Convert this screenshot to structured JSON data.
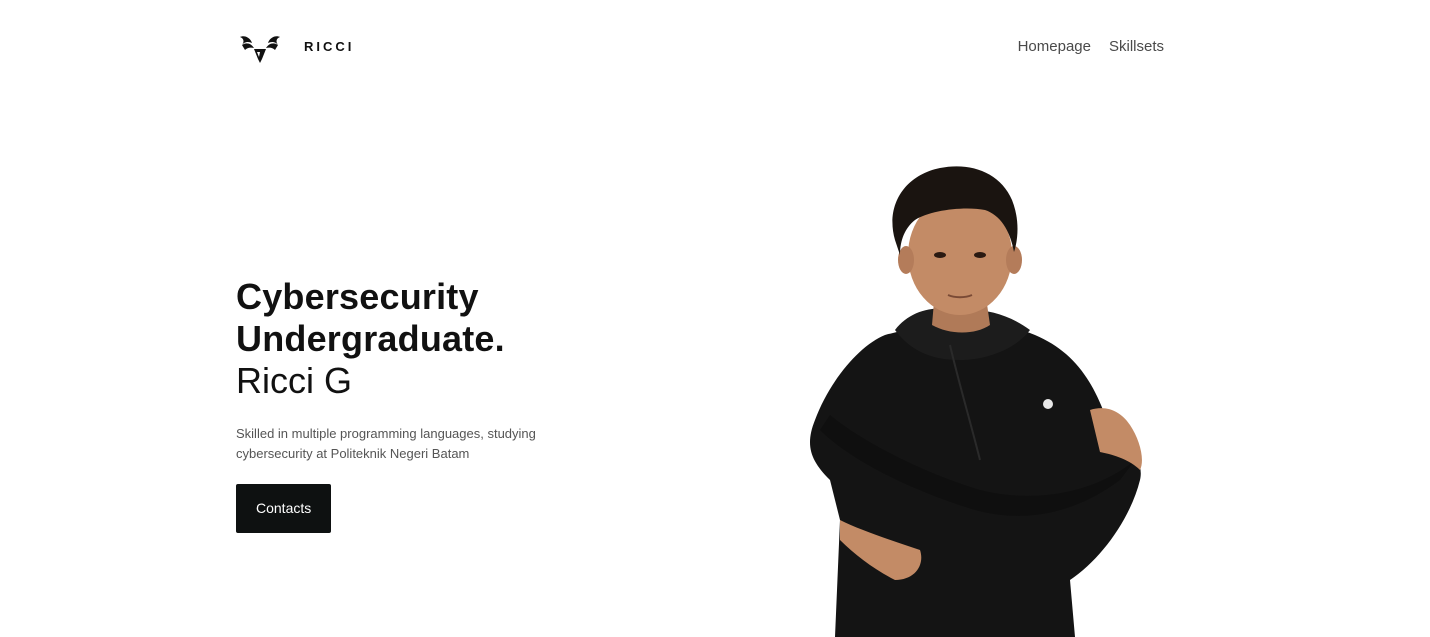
{
  "brand": {
    "name": "RICCI"
  },
  "nav": {
    "items": [
      {
        "label": "Homepage"
      },
      {
        "label": "Skillsets"
      }
    ]
  },
  "hero": {
    "title_line1": "Cybersecurity",
    "title_line2": "Undergraduate.",
    "name": "Ricci G",
    "description": "Skilled in multiple programming languages, studying cybersecurity at Politeknik Negeri Batam",
    "cta_label": "Contacts"
  },
  "colors": {
    "background": "#ffffff",
    "text": "#111111",
    "muted": "#555555",
    "button": "#0e1111"
  }
}
